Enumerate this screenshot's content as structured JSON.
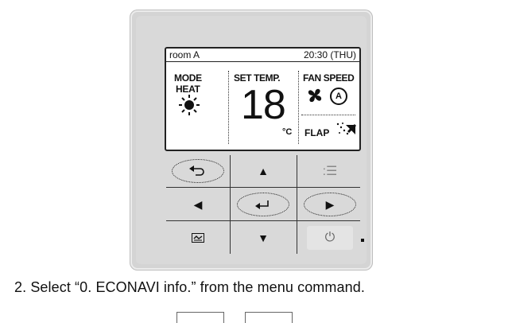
{
  "lcd": {
    "room": "room A",
    "clock": "20:30 (THU)",
    "mode_label": "MODE",
    "mode_value": "HEAT",
    "set_temp_label": "SET TEMP.",
    "set_temp_value": "18",
    "temp_unit": "°C",
    "fan_speed_label": "FAN SPEED",
    "fan_auto": "A",
    "flap_label": "FLAP"
  },
  "keys": {
    "up": "▲",
    "down": "▼",
    "left": "◀",
    "right": "▶",
    "menu": ":☰",
    "power": "⏻"
  },
  "instruction": "2.  Select “0. ECONAVI info.” from the menu command."
}
